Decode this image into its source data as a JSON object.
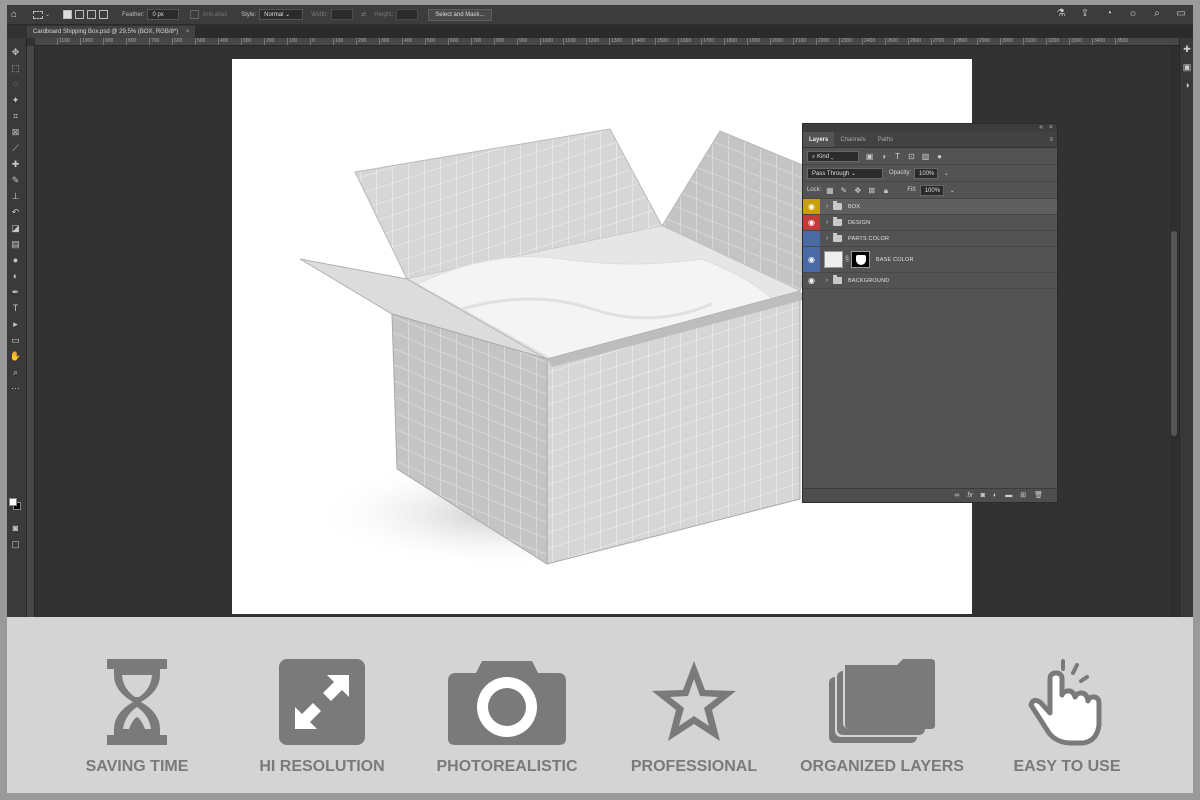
{
  "options_bar": {
    "feather_label": "Feather:",
    "feather_value": "0 px",
    "anti_alias_label": "Anti-alias",
    "style_label": "Style:",
    "style_value": "Normal",
    "width_label": "Width:",
    "height_label": "Height:",
    "select_mask_label": "Select and Mask..."
  },
  "document_tab": {
    "title": "Cardboard Shipping Box.psd @ 29,5% (BOX, RGB/8*)",
    "close": "×"
  },
  "ruler_labels": [
    "1100",
    "1000",
    "900",
    "800",
    "700",
    "600",
    "500",
    "400",
    "300",
    "200",
    "100",
    "0",
    "100",
    "200",
    "300",
    "400",
    "500",
    "600",
    "700",
    "800",
    "900",
    "1000",
    "1100",
    "1200",
    "1300",
    "1400",
    "1500",
    "1600",
    "1700",
    "1800",
    "1900",
    "2000",
    "2100",
    "2200",
    "2300",
    "2400",
    "2500",
    "2600",
    "2700",
    "2800",
    "2900",
    "3000",
    "3100",
    "3200",
    "3300",
    "3400",
    "3500"
  ],
  "layers_panel": {
    "tabs": [
      "Layers",
      "Channels",
      "Paths"
    ],
    "filter_kind": "Kind",
    "blend_mode": "Pass Through",
    "opacity_label": "Opacity:",
    "opacity_value": "100%",
    "lock_label": "Lock:",
    "fill_label": "Fill:",
    "fill_value": "100%",
    "layers": [
      {
        "name": "BOX",
        "color": "#c9a100",
        "visible": true,
        "selected": true
      },
      {
        "name": "DESIGN",
        "color": "#c43a3a",
        "visible": true,
        "selected": false
      },
      {
        "name": "PARTS COLOR",
        "color": "#4a6aa6",
        "visible": false,
        "selected": false
      },
      {
        "name": "BASE COLOR",
        "color": "#4a6aa6",
        "visible": true,
        "selected": false
      },
      {
        "name": "BACKGROUND",
        "color": "",
        "visible": true,
        "selected": false
      }
    ]
  },
  "features": [
    {
      "label": "SAVING TIME",
      "icon": "hourglass-icon"
    },
    {
      "label": "HI RESOLUTION",
      "icon": "expand-arrows-icon"
    },
    {
      "label": "PHOTOREALISTIC",
      "icon": "camera-icon"
    },
    {
      "label": "PROFESSIONAL",
      "icon": "star-icon"
    },
    {
      "label": "ORGANIZED LAYERS",
      "icon": "layered-folders-icon"
    },
    {
      "label": "EASY TO USE",
      "icon": "pointing-hand-icon"
    }
  ],
  "colors": {
    "feature_icon": "#7a7a7a",
    "feature_bg": "#d4d4d4",
    "frame": "#9a9a9a"
  }
}
